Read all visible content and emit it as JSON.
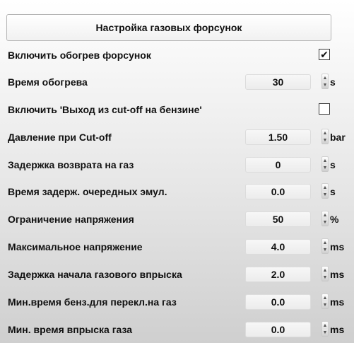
{
  "header": {
    "title": "Настройка газовых форсунок"
  },
  "rows": [
    {
      "label": "Включить обогрев форсунок",
      "type": "checkbox",
      "checked": true,
      "check_glyph": "✔"
    },
    {
      "label": "Время обогрева",
      "type": "spin",
      "value": "30",
      "unit": "s"
    },
    {
      "label": "Включить 'Выход из cut-off на бензине'",
      "type": "checkbox",
      "checked": false,
      "check_glyph": ""
    },
    {
      "label": "Давление при Cut-off",
      "type": "spin",
      "value": "1.50",
      "unit": "bar"
    },
    {
      "label": "Задержка возврата на газ",
      "type": "spin",
      "value": "0",
      "unit": "s"
    },
    {
      "label": "Время задерж. очередных эмул.",
      "type": "spin",
      "value": "0.0",
      "unit": "s"
    },
    {
      "label": "Ограничение напряжения",
      "type": "spin",
      "value": "50",
      "unit": "%"
    },
    {
      "label": "Максимальное напряжение",
      "type": "spin",
      "value": "4.0",
      "unit": "ms"
    },
    {
      "label": "Задержка начала газового впрыска",
      "type": "spin",
      "value": "2.0",
      "unit": "ms"
    },
    {
      "label": "Мин.время бенз.для перекл.на газ",
      "type": "spin",
      "value": "0.0",
      "unit": "ms"
    },
    {
      "label": "Мин. время впрыска газа",
      "type": "spin",
      "value": "0.0",
      "unit": "ms"
    }
  ],
  "icons": {
    "spin_up": "▲",
    "spin_down": "▼"
  }
}
